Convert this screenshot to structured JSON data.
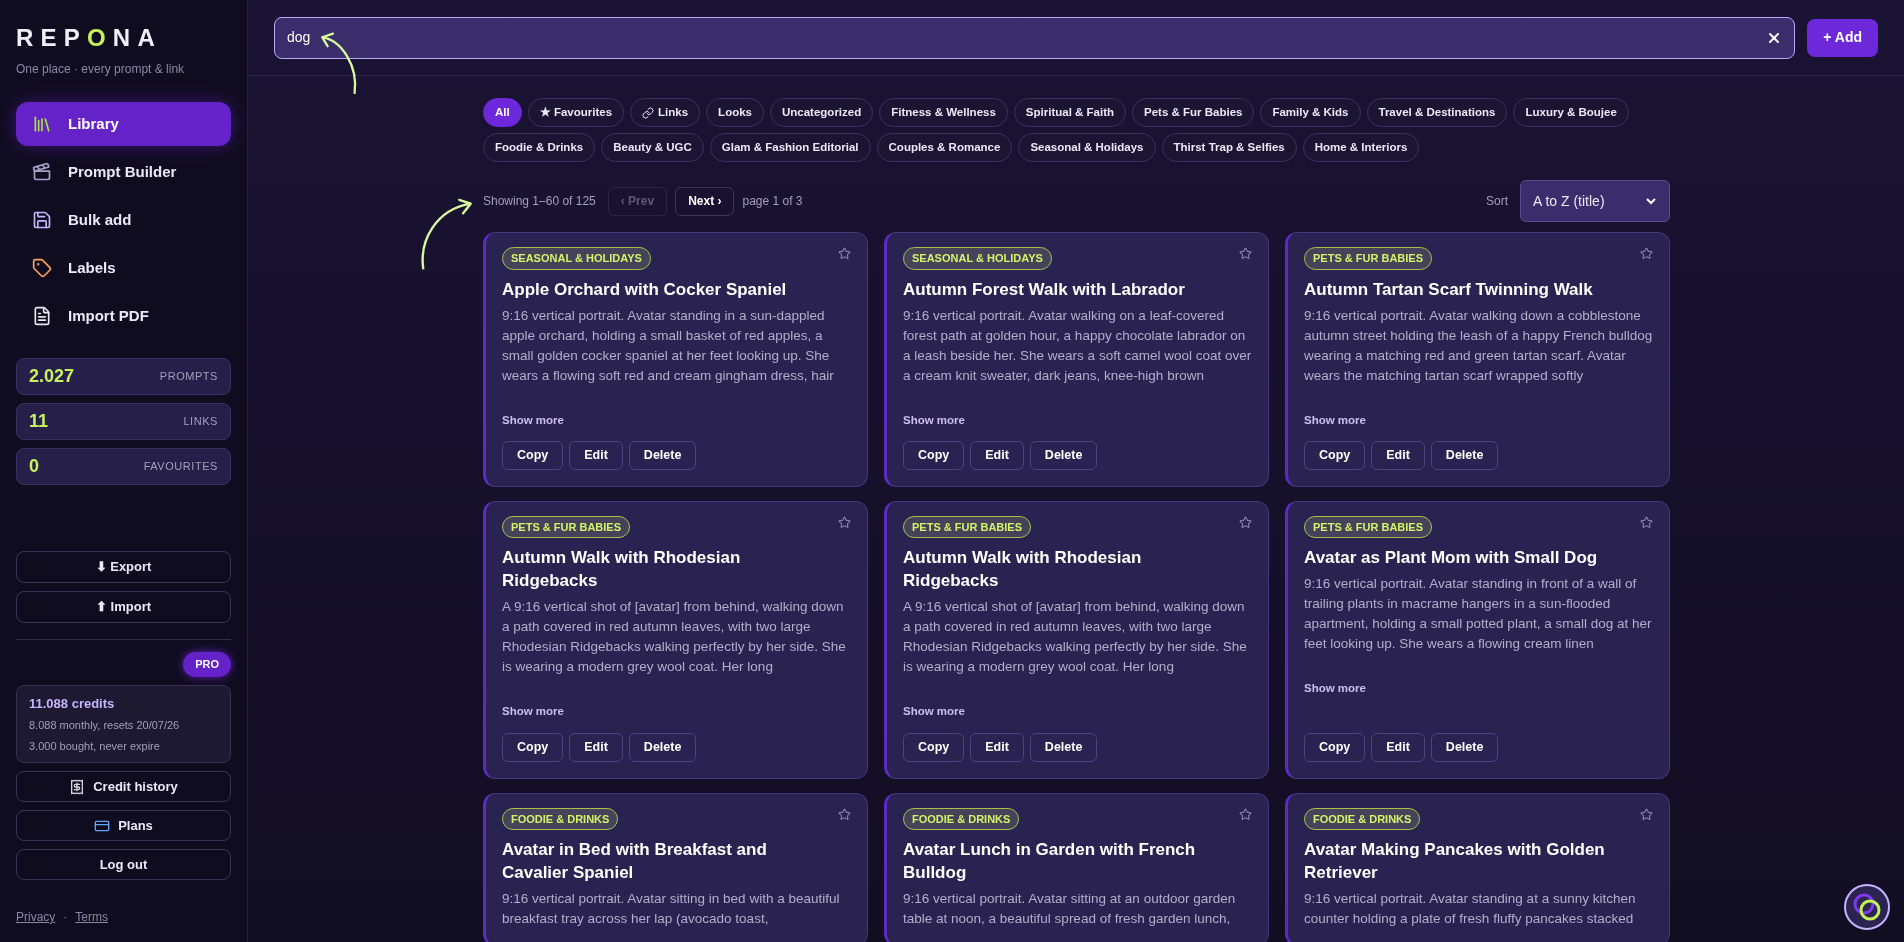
{
  "brand": {
    "name": "REPONA",
    "tagline": "One place · every prompt & link"
  },
  "nav": [
    {
      "label": "Library",
      "selected": true,
      "kind": "books"
    },
    {
      "label": "Prompt Builder",
      "selected": false,
      "kind": "clapper"
    },
    {
      "label": "Bulk add",
      "selected": false,
      "kind": "disk"
    },
    {
      "label": "Labels",
      "selected": false,
      "kind": "tag"
    },
    {
      "label": "Import PDF",
      "selected": false,
      "kind": "doc"
    }
  ],
  "stats": [
    {
      "value": "2.027",
      "label": "PROMPTS"
    },
    {
      "value": "11",
      "label": "LINKS"
    },
    {
      "value": "0",
      "label": "FAVOURITES"
    }
  ],
  "transfer_buttons": [
    "⬇ Export",
    "⬆ Import"
  ],
  "plan_badge": "PRO",
  "credits": {
    "total": "11.088 credits",
    "monthly": "8.088 monthly, resets 20/07/26",
    "bought": "3.000 bought, never expire"
  },
  "account_buttons": [
    {
      "label": "Credit history",
      "kind": "receipt"
    },
    {
      "label": "Plans",
      "kind": "card"
    },
    {
      "label": "Log out",
      "kind": "plain"
    }
  ],
  "footer_links": [
    "Privacy",
    "Terms"
  ],
  "footer_separator": "·",
  "search": {
    "value": "dog"
  },
  "add_button": "+ Add",
  "filters": [
    {
      "label": "All",
      "selected": true,
      "kind": "plain"
    },
    {
      "label": "★ Favourites",
      "selected": false,
      "kind": "plain"
    },
    {
      "label": "Links",
      "selected": false,
      "kind": "link"
    },
    {
      "label": "Looks",
      "selected": false,
      "kind": "plain"
    },
    {
      "label": "Uncategorized",
      "selected": false,
      "kind": "plain"
    },
    {
      "label": "Fitness & Wellness",
      "selected": false,
      "kind": "plain"
    },
    {
      "label": "Spiritual & Faith",
      "selected": false,
      "kind": "plain"
    },
    {
      "label": "Pets & Fur Babies",
      "selected": false,
      "kind": "plain"
    },
    {
      "label": "Family & Kids",
      "selected": false,
      "kind": "plain"
    },
    {
      "label": "Travel & Destinations",
      "selected": false,
      "kind": "plain"
    },
    {
      "label": "Luxury & Boujee",
      "selected": false,
      "kind": "plain"
    },
    {
      "label": "Foodie & Drinks",
      "selected": false,
      "kind": "plain"
    },
    {
      "label": "Beauty & UGC",
      "selected": false,
      "kind": "plain"
    },
    {
      "label": "Glam & Fashion Editorial",
      "selected": false,
      "kind": "plain"
    },
    {
      "label": "Couples & Romance",
      "selected": false,
      "kind": "plain"
    },
    {
      "label": "Seasonal & Holidays",
      "selected": false,
      "kind": "plain"
    },
    {
      "label": "Thirst Trap & Selfies",
      "selected": false,
      "kind": "plain"
    },
    {
      "label": "Home & Interiors",
      "selected": false,
      "kind": "plain"
    }
  ],
  "pagination": {
    "summary": "Showing 1–60 of 125",
    "prev": "‹ Prev",
    "prev_disabled": true,
    "next": "Next ›",
    "page": "page 1 of 3"
  },
  "sort": {
    "label": "Sort",
    "value": "A to Z (title)"
  },
  "cards": [
    {
      "tag": "SEASONAL & HOLIDAYS",
      "favourite": false,
      "title": "Apple Orchard with Cocker Spaniel",
      "text": "9:16 vertical portrait. Avatar standing in a sun-dappled apple orchard, holding a small basket of red apples, a small golden cocker spaniel at her feet looking up. She wears a flowing soft red and cream gingham dress, hair",
      "show_more": "Show more",
      "actions": [
        "Copy",
        "Edit",
        "Delete"
      ]
    },
    {
      "tag": "SEASONAL & HOLIDAYS",
      "favourite": false,
      "title": "Autumn Forest Walk with Labrador",
      "text": "9:16 vertical portrait. Avatar walking on a leaf-covered forest path at golden hour, a happy chocolate labrador on a leash beside her. She wears a soft camel wool coat over a cream knit sweater, dark jeans, knee-high brown",
      "show_more": "Show more",
      "actions": [
        "Copy",
        "Edit",
        "Delete"
      ]
    },
    {
      "tag": "PETS & FUR BABIES",
      "favourite": false,
      "title": "Autumn Tartan Scarf Twinning Walk",
      "text": "9:16 vertical portrait. Avatar walking down a cobblestone autumn street holding the leash of a happy French bulldog wearing a matching red and green tartan scarf. Avatar wears the matching tartan scarf wrapped softly",
      "show_more": "Show more",
      "actions": [
        "Copy",
        "Edit",
        "Delete"
      ]
    },
    {
      "tag": "PETS & FUR BABIES",
      "favourite": false,
      "title": "Autumn Walk with Rhodesian Ridgebacks",
      "text": "A 9:16 vertical shot of [avatar] from behind, walking down a path covered in red autumn leaves, with two large Rhodesian Ridgebacks walking perfectly by her side. She is wearing a modern grey wool coat. Her long",
      "show_more": "Show more",
      "actions": [
        "Copy",
        "Edit",
        "Delete"
      ]
    },
    {
      "tag": "PETS & FUR BABIES",
      "favourite": false,
      "title": "Autumn Walk with Rhodesian Ridgebacks",
      "text": "A 9:16 vertical shot of [avatar] from behind, walking down a path covered in red autumn leaves, with two large Rhodesian Ridgebacks walking perfectly by her side. She is wearing a modern grey wool coat. Her long",
      "show_more": "Show more",
      "actions": [
        "Copy",
        "Edit",
        "Delete"
      ]
    },
    {
      "tag": "PETS & FUR BABIES",
      "favourite": false,
      "title": "Avatar as Plant Mom with Small Dog",
      "text": "9:16 vertical portrait. Avatar standing in front of a wall of trailing plants in macrame hangers in a sun-flooded apartment, holding a small potted plant, a small dog at her feet looking up. She wears a flowing cream linen",
      "show_more": "Show more",
      "actions": [
        "Copy",
        "Edit",
        "Delete"
      ]
    },
    {
      "tag": "FOODIE & DRINKS",
      "favourite": false,
      "title": "Avatar in Bed with Breakfast and Cavalier Spaniel",
      "text": "9:16 vertical portrait. Avatar sitting in bed with a beautiful breakfast tray across her lap (avocado toast,"
    },
    {
      "tag": "FOODIE & DRINKS",
      "favourite": false,
      "title": "Avatar Lunch in Garden with French Bulldog",
      "text": "9:16 vertical portrait. Avatar sitting at an outdoor garden table at noon, a beautiful spread of fresh garden lunch,"
    },
    {
      "tag": "FOODIE & DRINKS",
      "favourite": false,
      "title": "Avatar Making Pancakes with Golden Retriever",
      "text": "9:16 vertical portrait. Avatar standing at a sunny kitchen counter holding a plate of fresh fluffy pancakes stacked"
    }
  ]
}
